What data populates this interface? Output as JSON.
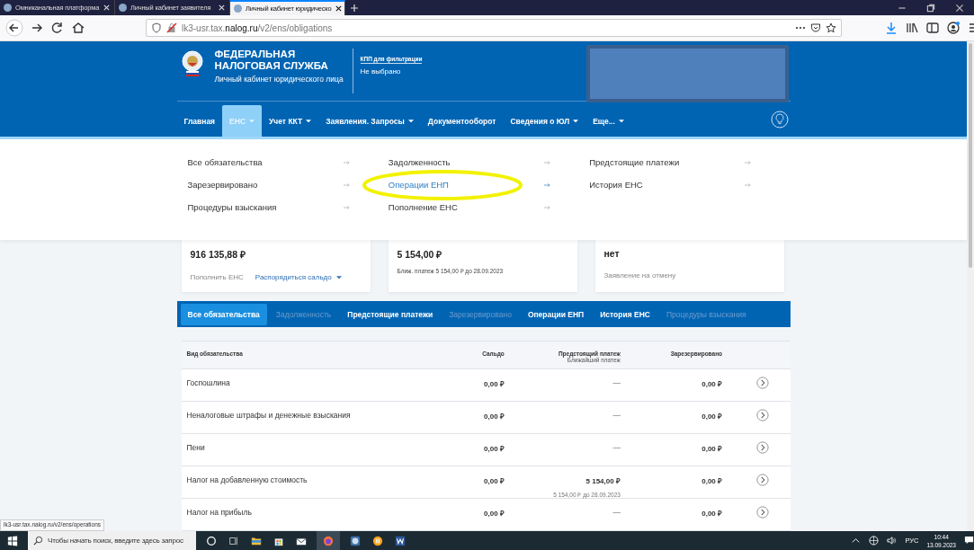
{
  "browser": {
    "tabs": [
      {
        "title": "Омниканальная платформа",
        "selected": false
      },
      {
        "title": "Личный кабинет заявителя",
        "selected": false
      },
      {
        "title": "Личный кабинет юридическо",
        "selected": true
      }
    ],
    "url": "lk3-usr.tax.**nalog.ru**/v2/ens/obligations",
    "status_url": "lk3-usr.tax.nalog.ru/v2/ens/operations"
  },
  "header": {
    "title_lines": [
      "ФЕДЕРАЛЬНАЯ",
      "НАЛОГОВАЯ СЛУЖБА"
    ],
    "subtitle": "Личный кабинет юридического лица",
    "kpp_label": "КПП для фильтрации",
    "kpp_value": "Не выбрано"
  },
  "nav": [
    {
      "label": "Главная",
      "selected": false,
      "has_menu": false
    },
    {
      "label": "ЕНС",
      "selected": true,
      "has_menu": true
    },
    {
      "label": "Учет ККТ",
      "selected": false,
      "has_menu": true
    },
    {
      "label": "Заявления. Запросы",
      "selected": false,
      "has_menu": true
    },
    {
      "label": "Документооборот",
      "selected": false,
      "has_menu": false
    },
    {
      "label": "Сведения о ЮЛ",
      "selected": false,
      "has_menu": true
    },
    {
      "label": "Еще...",
      "selected": false,
      "has_menu": true
    }
  ],
  "dropdown": [
    [
      {
        "label": "Все обязательства",
        "selected": false
      },
      {
        "label": "Зарезервировано",
        "selected": false
      },
      {
        "label": "Процедуры взыскания",
        "selected": false
      }
    ],
    [
      {
        "label": "Задолженность",
        "selected": false
      },
      {
        "label": "Операции ЕНП",
        "selected": true
      },
      {
        "label": "Пополнение ЕНС",
        "selected": false
      }
    ],
    [
      {
        "label": "Предстоящие платежи",
        "selected": false
      },
      {
        "label": "История ЕНС",
        "selected": false
      }
    ]
  ],
  "cards": [
    {
      "amount": "916 135,88 ₽",
      "links": [
        {
          "label": "Пополнить ЕНС",
          "kind": "muted"
        },
        {
          "label": "Распорядиться сальдо",
          "kind": "menu"
        }
      ]
    },
    {
      "amount": "5 154,00 ₽",
      "note": "Ближ. платеж 5 154,00 ₽ до 28.09.2023"
    },
    {
      "amount": "нет",
      "links": [
        {
          "label": "Заявление на отмену",
          "kind": "muted"
        }
      ]
    }
  ],
  "tabs": [
    {
      "label": "Все обязательства",
      "selected": true,
      "disabled": false
    },
    {
      "label": "Задолженность",
      "selected": false,
      "disabled": true
    },
    {
      "label": "Предстоящие платежи",
      "selected": false,
      "disabled": false
    },
    {
      "label": "Зарезервировано",
      "selected": false,
      "disabled": true
    },
    {
      "label": "Операции ЕНП",
      "selected": false,
      "disabled": false
    },
    {
      "label": "История ЕНС",
      "selected": false,
      "disabled": false
    },
    {
      "label": "Процедуры взыскания",
      "selected": false,
      "disabled": true
    }
  ],
  "table": {
    "columns": [
      {
        "label": "Вид обязательства"
      },
      {
        "label": "Сальдо"
      },
      {
        "label": "Предстоящий платеж",
        "sub": "Ближайший платеж"
      },
      {
        "label": "Зарезервировано"
      }
    ],
    "rows": [
      {
        "name": "Госпошлина",
        "saldo": "0,00 ₽",
        "upcoming": "—",
        "reserved": "0,00 ₽"
      },
      {
        "name": "Неналоговые штрафы и денежные взыскания",
        "saldo": "0,00 ₽",
        "upcoming": "—",
        "reserved": "0,00 ₽"
      },
      {
        "name": "Пени",
        "saldo": "0,00 ₽",
        "upcoming": "—",
        "reserved": "0,00 ₽"
      },
      {
        "name": "Налог на добавленную стоимость",
        "saldo": "0,00 ₽",
        "upcoming": "5 154,00 ₽",
        "upcoming_note": "5 154,00 ₽ до 28.09.2023",
        "reserved": "0,00 ₽"
      },
      {
        "name": "Налог на прибыль",
        "saldo": "0,00 ₽",
        "upcoming": "—",
        "reserved": "0,00 ₽"
      }
    ]
  },
  "taskbar": {
    "search_placeholder": "Чтобы начать поиск, введите здесь запрос",
    "language": "РУС",
    "time": "10:44",
    "date": "13.09.2023"
  }
}
